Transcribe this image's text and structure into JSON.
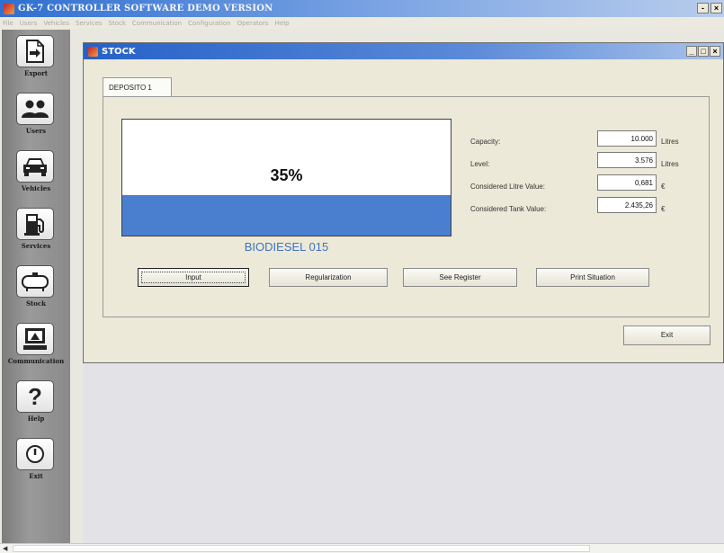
{
  "app": {
    "title": "GK-7 CONTROLLER SOFTWARE  DEMO VERSION",
    "window_buttons": [
      "-",
      "×"
    ]
  },
  "menu": [
    "File",
    "Users",
    "Vehicles",
    "Services",
    "Stock",
    "Communication",
    "Configuration",
    "Operators",
    "Help"
  ],
  "sidebar": {
    "items": [
      {
        "label": "Export",
        "icon": "export-icon"
      },
      {
        "label": "Users",
        "icon": "users-icon"
      },
      {
        "label": "Vehicles",
        "icon": "vehicle-icon"
      },
      {
        "label": "Services",
        "icon": "fuel-pump-icon"
      },
      {
        "label": "Stock",
        "icon": "tank-icon"
      },
      {
        "label": "Communication",
        "icon": "communication-icon"
      },
      {
        "label": "Help",
        "icon": "help-icon"
      },
      {
        "label": "Exit",
        "icon": "exit-icon"
      }
    ]
  },
  "stock_window": {
    "title": "STOCK",
    "window_buttons": [
      "_",
      "□",
      "×"
    ],
    "tab": "DEPOSITO 1",
    "tank": {
      "level_text": "35%",
      "level_fraction": 0.35,
      "fill_color": "#4a7fd0",
      "product": "BIODIESEL 015"
    },
    "fields": {
      "capacity": {
        "label": "Capacity:",
        "value": "10.000",
        "unit": "Litres"
      },
      "level": {
        "label": "Level:",
        "value": "3.576",
        "unit": "Litres"
      },
      "litre_value": {
        "label": "Considered Litre Value:",
        "value": "0,681",
        "unit": "€"
      },
      "tank_value": {
        "label": "Considered Tank Value:",
        "value": "2.435,26",
        "unit": "€"
      }
    },
    "buttons": {
      "input": "Input",
      "regularization": "Regularization",
      "see_register": "See Register",
      "print_situation": "Print Situation",
      "exit": "Exit"
    }
  }
}
